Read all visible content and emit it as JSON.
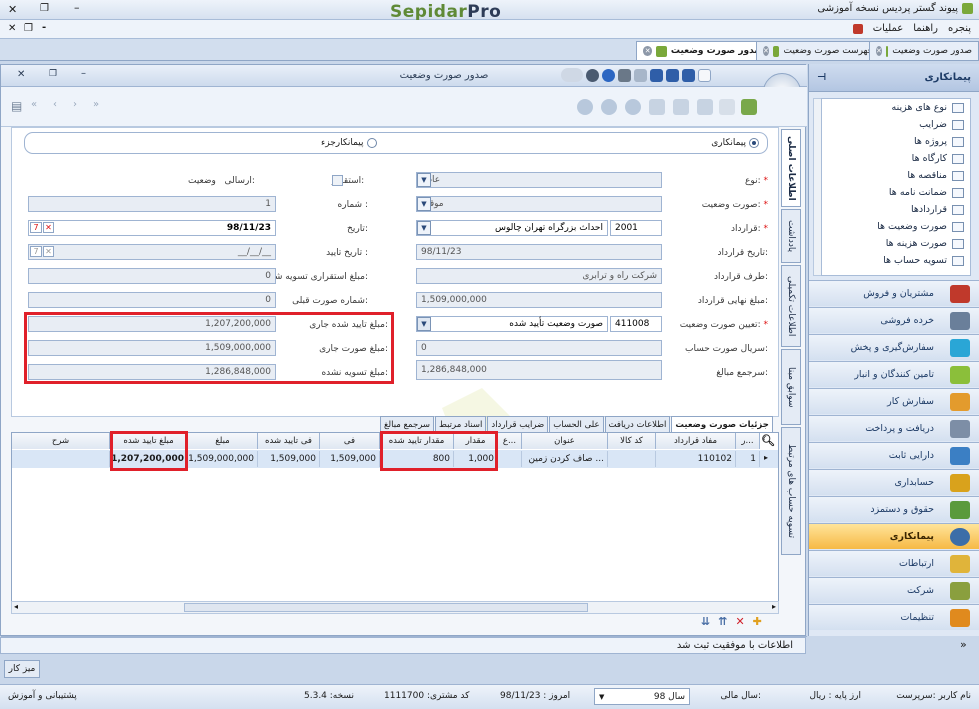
{
  "app": {
    "title": "پیوند گستر پردیس نسخه آموزشی",
    "logo_a": "Sepidar",
    "logo_b": "Pro"
  },
  "menu": [
    "عملیات",
    "راهنما",
    "پنجره"
  ],
  "doc_tabs": [
    {
      "label": "صدور صورت وضعیت",
      "active": true
    },
    {
      "label": "فهرست صورت وضعیت",
      "active": false
    },
    {
      "label": "صدور صورت وضعیت",
      "active": false
    }
  ],
  "window": {
    "title": "صدور صورت وضعیت"
  },
  "nav": {
    "header": "پیمانکاری",
    "tree": [
      "نوع های هزینه",
      "ضرایب",
      "پروژه ها",
      "کارگاه ها",
      "مناقصه ها",
      "ضمانت نامه ها",
      "قراردادها",
      "صورت وضعیت ها",
      "صورت هزینه ها",
      "تسویه حساب ها"
    ],
    "categories": [
      {
        "label": "مشتریان و فروش",
        "color": "#c0392b"
      },
      {
        "label": "خرده فروشی",
        "color": "#6a7f9a"
      },
      {
        "label": "سفارش‌گیری و پخش",
        "color": "#2aa6d6"
      },
      {
        "label": "تامین کنندگان و انبار",
        "color": "#8bbf3a"
      },
      {
        "label": "سفارش کار",
        "color": "#e39b2d"
      },
      {
        "label": "دریافت و پرداخت",
        "color": "#7d8ea6"
      },
      {
        "label": "دارایی ثابت",
        "color": "#3b7fc4"
      },
      {
        "label": "حسابداری",
        "color": "#d9a21c"
      },
      {
        "label": "حقوق و دستمزد",
        "color": "#5a9a3c"
      },
      {
        "label": "پیمانکاری",
        "color": "#3c6ea8",
        "selected": true
      },
      {
        "label": "ارتباطات",
        "color": "#e0b43a"
      },
      {
        "label": "شرکت",
        "color": "#8a9f3e"
      },
      {
        "label": "تنظیمات",
        "color": "#e08a1e"
      }
    ]
  },
  "side_tabs": [
    "اطلاعات اصلی",
    "یادداشت",
    "اطلاعات تکمیلی",
    "سوابق مبنا",
    "تسویه حساب های مرتبط"
  ],
  "form": {
    "radio_main": "پیمانکاری",
    "radio_sub": "پیمانکارجزء",
    "type_label": "نوع:",
    "type_value": "عادی",
    "status_label": "صورت وضعیت:",
    "status_value": "موقت",
    "contract_label": "قرارداد:",
    "contract_code": "2001",
    "contract_name": "احداث بزرگراه تهران چالوس",
    "contract_date_label": "تاریخ قرارداد:",
    "contract_date": "98/11/23",
    "party_label": "طرف قرارداد:",
    "party_value": "شرکت راه و ترابری",
    "final_amount_label": "مبلغ نهایی قرارداد:",
    "final_amount": "1,509,000,000",
    "determine_label": "تعیین صورت وضعیت:",
    "determine_code": "411008",
    "determine_value": "صورت وضعیت تأیید شده",
    "serial_label": "سریال صورت حساب:",
    "serial_value": "0",
    "sum_label": "سرجمع مبالغ:",
    "sum_value": "1,286,848,000",
    "state_label": "وضعیت:",
    "state_value": "ارسالی",
    "stable_label": "استقرار:",
    "number_label": "شماره :",
    "number_value": "1",
    "date_label": "تاریخ:",
    "date_value": "98/11/23",
    "confirm_date_label": "تاریخ تایید :",
    "confirm_date_value": "__/__/__",
    "settle_label": "مبلغ استقراری تسویه شده:",
    "settle_value": "0",
    "prev_label": "شماره صورت قبلی:",
    "prev_value": "0",
    "approved_current_label": "مبلغ تایید شده جاری:",
    "approved_current_value": "1,207,200,000",
    "current_amount_label": "مبلغ صورت جاری:",
    "current_amount_value": "1,509,000,000",
    "unsettled_label": "مبلغ تسویه نشده:",
    "unsettled_value": "1,286,848,000"
  },
  "grid_tabs": [
    "جزئیات صورت وضعیت",
    "اطلاعات دریافت",
    "علی الحساب",
    "ضرایب قرارداد",
    "اسناد مرتبط",
    "سرجمع مبالغ"
  ],
  "grid": {
    "headers": [
      "ر...",
      "مفاد قرارداد",
      "کد کالا",
      "عنوان",
      "ع...",
      "مقدار",
      "مقدار تایید شده",
      "فی",
      "فی تایید شده",
      "مبلغ",
      "مبلغ تایید شده",
      "شرح"
    ],
    "row": [
      "1",
      "110102",
      "",
      "صاف کردن زمین ...",
      "",
      "1,000",
      "800",
      "1,509,000",
      "1,509,000",
      "1,509,000,000",
      "1,207,200,000",
      ""
    ]
  },
  "status_message": "اطلاعات با موفقیت ثبت شد",
  "desktop_tab": "میز کار",
  "statusbar": {
    "user": "نام کاربر :سرپرست",
    "currency": "ارز پایه : ریال",
    "fiscal_label": "سال مالی:",
    "fiscal_value": "سال 98",
    "today": "امروز : 98/11/23",
    "customer": "کد مشتری: 1111700",
    "version": "نسخه: 5.3.4",
    "support": "پشتیبانی و آموزش"
  }
}
